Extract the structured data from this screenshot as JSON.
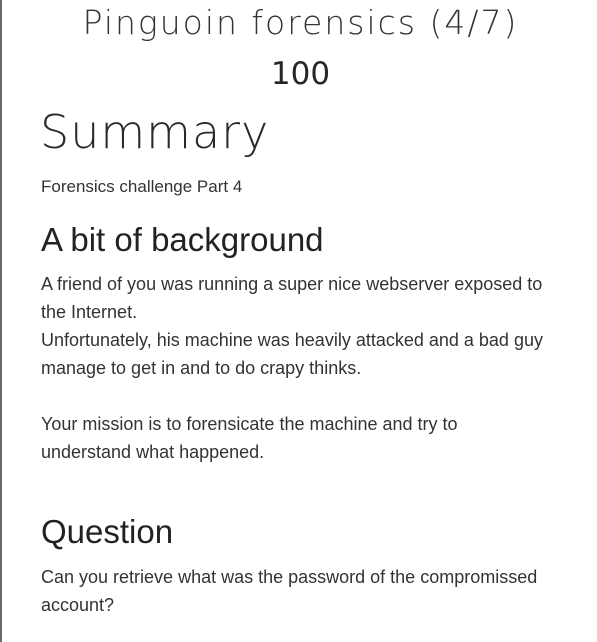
{
  "challenge": {
    "name": "Pinguoin forensics (4/7)",
    "value": "100"
  },
  "summary": {
    "title": "Summary",
    "text": "Forensics challenge Part 4"
  },
  "background": {
    "title": "A bit of background",
    "lines": [
      "A friend of you was running a super nice webserver exposed to",
      "the Internet.",
      "Unfortunately, his machine was heavily attacked and a bad guy",
      "manage to get in and to do crapy thinks.",
      "",
      "Your mission is to forensicate the machine and try to",
      "understand what happened."
    ]
  },
  "question": {
    "title": "Question",
    "lines": [
      "Can you retrieve what was the password of the compromissed",
      "account?"
    ]
  }
}
